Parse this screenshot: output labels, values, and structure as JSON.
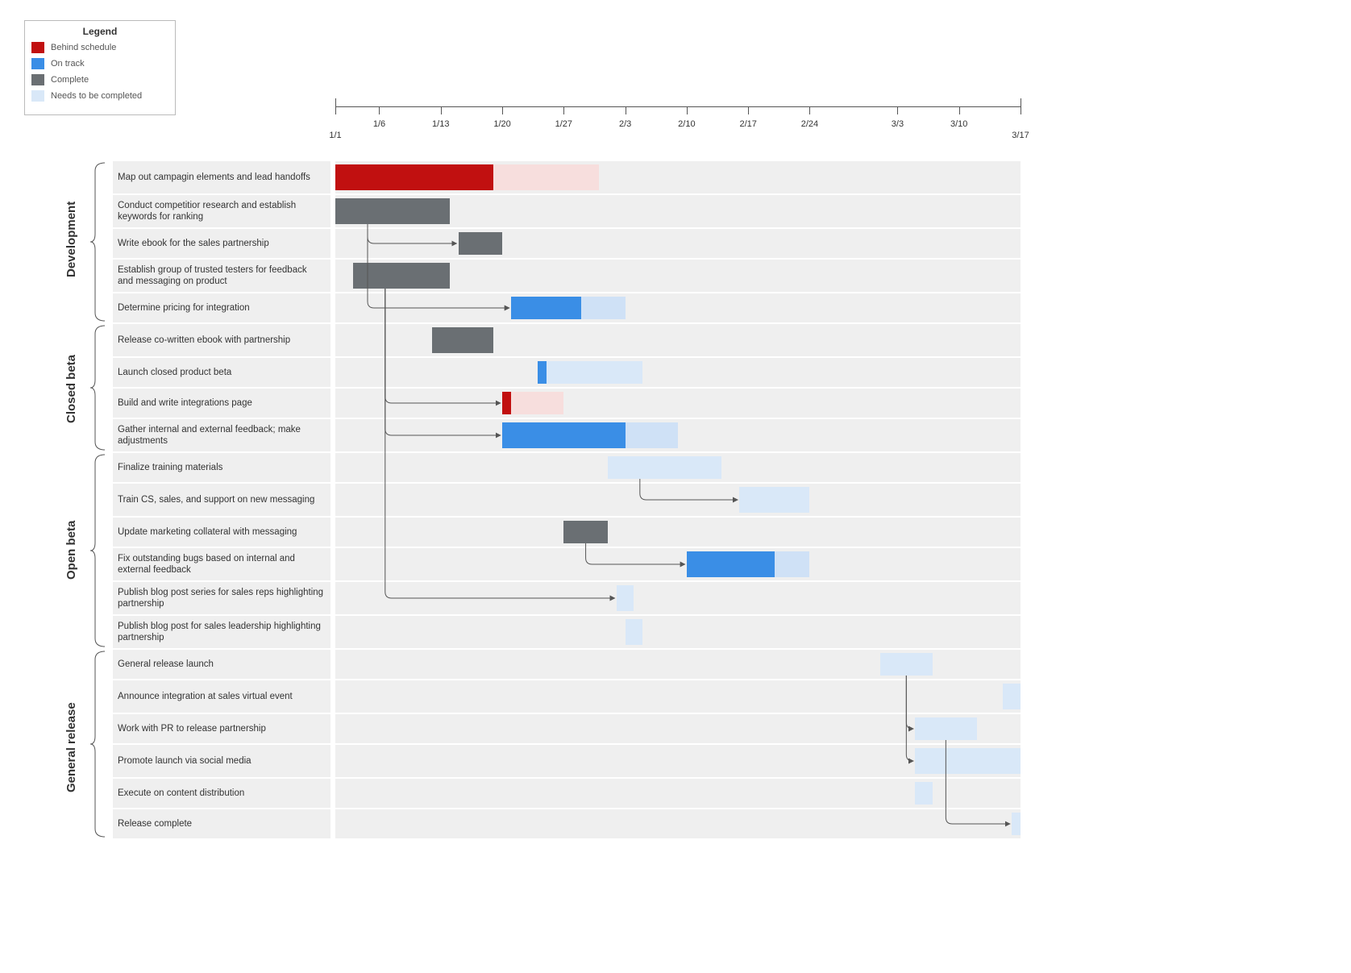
{
  "legend": {
    "title": "Legend",
    "items": [
      {
        "color": "#c11010",
        "label": "Behind schedule"
      },
      {
        "color": "#3a8ee6",
        "label": "On track"
      },
      {
        "color": "#6a6f73",
        "label": "Complete"
      },
      {
        "color": "#d9e8f8",
        "label": "Needs to be completed"
      }
    ]
  },
  "colors": {
    "behind": "#c11010",
    "behind_light": "#f7dedd",
    "ontrack": "#3a8ee6",
    "ontrack_light": "#cfe1f6",
    "complete": "#6a6f73",
    "needs": "#d9e8f8",
    "row_bg": "#efefef"
  },
  "phases": [
    {
      "label": "Development",
      "rows": [
        0,
        1,
        2,
        3,
        4
      ]
    },
    {
      "label": "Closed beta",
      "rows": [
        5,
        6,
        7,
        8
      ]
    },
    {
      "label": "Open beta",
      "rows": [
        9,
        10,
        11,
        12,
        13,
        14
      ]
    },
    {
      "label": "General release",
      "rows": [
        15,
        16,
        17,
        18,
        19,
        20
      ]
    }
  ],
  "chart_data": {
    "type": "gantt",
    "x_axis": {
      "start": "1/1",
      "end": "3/17",
      "ticks": [
        "1/6",
        "1/13",
        "1/20",
        "1/27",
        "2/3",
        "2/10",
        "2/17",
        "2/24",
        "3/3",
        "3/10"
      ]
    },
    "status_legend": {
      "behind": "Behind schedule",
      "ontrack": "On track",
      "complete": "Complete",
      "needs": "Needs to be completed"
    },
    "tasks": [
      {
        "id": "t0",
        "phase": "Development",
        "label": "Map out campagin elements and lead handoffs",
        "bars": [
          {
            "status": "behind",
            "start": "1/1",
            "end": "1/19"
          },
          {
            "status": "behind_light",
            "start": "1/19",
            "end": "1/31"
          }
        ]
      },
      {
        "id": "t1",
        "phase": "Development",
        "label": "Conduct competitior research and establish keywords for ranking",
        "bars": [
          {
            "status": "complete",
            "start": "1/1",
            "end": "1/14"
          }
        ]
      },
      {
        "id": "t2",
        "phase": "Development",
        "label": "Write ebook for the sales partnership",
        "bars": [
          {
            "status": "complete",
            "start": "1/15",
            "end": "1/20"
          }
        ]
      },
      {
        "id": "t3",
        "phase": "Development",
        "label": "Establish group of trusted testers for feedback and messaging on product",
        "bars": [
          {
            "status": "complete",
            "start": "1/3",
            "end": "1/14"
          }
        ]
      },
      {
        "id": "t4",
        "phase": "Development",
        "label": "Determine pricing for integration",
        "bars": [
          {
            "status": "ontrack",
            "start": "1/21",
            "end": "1/29"
          },
          {
            "status": "ontrack_light",
            "start": "1/29",
            "end": "2/3"
          }
        ]
      },
      {
        "id": "t5",
        "phase": "Closed beta",
        "label": "Release co-written ebook with partnership",
        "bars": [
          {
            "status": "complete",
            "start": "1/12",
            "end": "1/19"
          }
        ]
      },
      {
        "id": "t6",
        "phase": "Closed beta",
        "label": "Launch closed product beta",
        "bars": [
          {
            "status": "ontrack",
            "start": "1/24",
            "end": "1/25"
          },
          {
            "status": "needs",
            "start": "1/25",
            "end": "2/5"
          }
        ]
      },
      {
        "id": "t7",
        "phase": "Closed beta",
        "label": "Build and write integrations page",
        "bars": [
          {
            "status": "behind",
            "start": "1/20",
            "end": "1/21"
          },
          {
            "status": "behind_light",
            "start": "1/21",
            "end": "1/27"
          }
        ]
      },
      {
        "id": "t8",
        "phase": "Closed beta",
        "label": "Gather internal and external feedback; make adjustments",
        "bars": [
          {
            "status": "ontrack",
            "start": "1/20",
            "end": "2/3"
          },
          {
            "status": "ontrack_light",
            "start": "2/3",
            "end": "2/9"
          }
        ]
      },
      {
        "id": "t9",
        "phase": "Open beta",
        "label": "Finalize training materials",
        "bars": [
          {
            "status": "needs",
            "start": "2/1",
            "end": "2/14"
          }
        ]
      },
      {
        "id": "t10",
        "phase": "Open beta",
        "label": "Train CS, sales, and support on new messaging",
        "bars": [
          {
            "status": "needs",
            "start": "2/16",
            "end": "2/24"
          }
        ]
      },
      {
        "id": "t11",
        "phase": "Open beta",
        "label": "Update marketing collateral with messaging",
        "bars": [
          {
            "status": "complete",
            "start": "1/27",
            "end": "2/1"
          }
        ]
      },
      {
        "id": "t12",
        "phase": "Open beta",
        "label": "Fix outstanding bugs based on internal and external feedback",
        "bars": [
          {
            "status": "ontrack",
            "start": "2/10",
            "end": "2/20"
          },
          {
            "status": "ontrack_light",
            "start": "2/20",
            "end": "2/24"
          }
        ]
      },
      {
        "id": "t13",
        "phase": "Open beta",
        "label": "Publish blog post series for sales reps highlighting partnership",
        "bars": [
          {
            "status": "needs",
            "start": "2/2",
            "end": "2/4"
          }
        ]
      },
      {
        "id": "t14",
        "phase": "Open beta",
        "label": "Publish blog post for sales leadership highlighting partnership",
        "bars": [
          {
            "status": "needs",
            "start": "2/3",
            "end": "2/5"
          }
        ]
      },
      {
        "id": "t15",
        "phase": "General release",
        "label": "General release launch",
        "bars": [
          {
            "status": "needs",
            "start": "3/1",
            "end": "3/7"
          }
        ]
      },
      {
        "id": "t16",
        "phase": "General release",
        "label": "Announce integration at sales virtual event",
        "bars": [
          {
            "status": "needs",
            "start": "3/15",
            "end": "3/17"
          }
        ]
      },
      {
        "id": "t17",
        "phase": "General release",
        "label": "Work with PR to release partnership",
        "bars": [
          {
            "status": "needs",
            "start": "3/5",
            "end": "3/12"
          }
        ]
      },
      {
        "id": "t18",
        "phase": "General release",
        "label": "Promote launch via social media",
        "bars": [
          {
            "status": "needs",
            "start": "3/5",
            "end": "3/17"
          }
        ]
      },
      {
        "id": "t19",
        "phase": "General release",
        "label": "Execute on content distribution",
        "bars": [
          {
            "status": "needs",
            "start": "3/5",
            "end": "3/7"
          }
        ]
      },
      {
        "id": "t20",
        "phase": "General release",
        "label": "Release complete",
        "bars": [
          {
            "status": "needs",
            "start": "3/16",
            "end": "3/17"
          }
        ]
      }
    ],
    "dependencies": [
      {
        "from": "t1",
        "to": "t2"
      },
      {
        "from": "t1",
        "to": "t4"
      },
      {
        "from": "t3",
        "to": "t7"
      },
      {
        "from": "t3",
        "to": "t8"
      },
      {
        "from": "t3",
        "to": "t13"
      },
      {
        "from": "t9",
        "to": "t10"
      },
      {
        "from": "t11",
        "to": "t12"
      },
      {
        "from": "t15",
        "to": "t17"
      },
      {
        "from": "t15",
        "to": "t18"
      },
      {
        "from": "t17",
        "to": "t20"
      }
    ]
  }
}
